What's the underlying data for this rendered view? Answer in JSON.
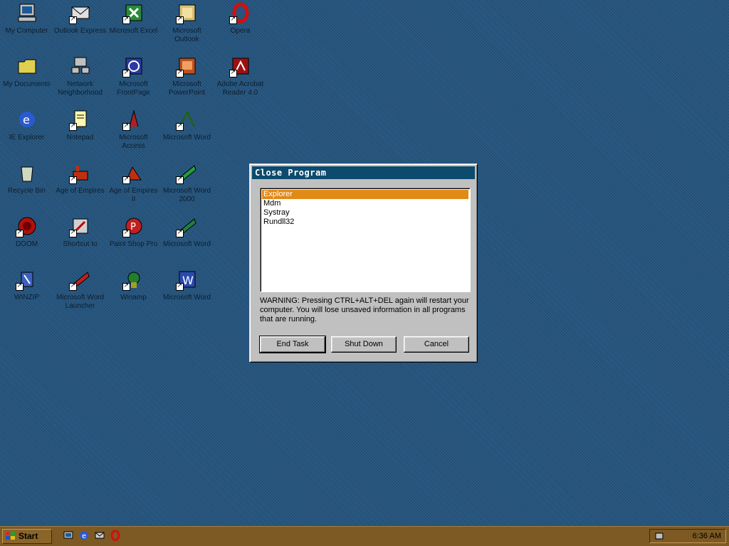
{
  "desktop": {
    "icons": [
      {
        "label": "My Computer"
      },
      {
        "label": "Outlook Express"
      },
      {
        "label": "Microsoft Excel"
      },
      {
        "label": "Microsoft Outlook"
      },
      {
        "label": "Opera"
      },
      {
        "label": "My Documents"
      },
      {
        "label": "Network Neighborhood"
      },
      {
        "label": "Microsoft FrontPage"
      },
      {
        "label": "Microsoft PowerPoint"
      },
      {
        "label": "Adobe Acrobat Reader 4.0"
      },
      {
        "label": "IE Explorer"
      },
      {
        "label": "Notepad"
      },
      {
        "label": "Microsoft Access"
      },
      {
        "label": "Microsoft Word"
      },
      {
        "label": "Recycle Bin"
      },
      {
        "label": "Age of Empires"
      },
      {
        "label": "Age of Empires II"
      },
      {
        "label": "Microsoft Word 2000"
      },
      {
        "label": "DOOM"
      },
      {
        "label": "Shortcut to"
      },
      {
        "label": "Paint Shop Pro"
      },
      {
        "label": "Microsoft Word"
      },
      {
        "label": "WINZIP"
      },
      {
        "label": "Microsoft Word Launcher"
      },
      {
        "label": "Winamp"
      },
      {
        "label": "Microsoft Word"
      }
    ]
  },
  "dialog": {
    "title": "Close Program",
    "tasks": [
      "Explorer",
      "Mdm",
      "Systray",
      "Rundll32"
    ],
    "selected_task": "Explorer",
    "warning": "WARNING: Pressing CTRL+ALT+DEL again will restart your computer. You will lose unsaved information in all programs that are running.",
    "buttons": {
      "end_task": "End Task",
      "shut_down": "Shut Down",
      "cancel": "Cancel"
    }
  },
  "taskbar": {
    "start_label": "Start",
    "clock": "6:36 AM"
  },
  "colors": {
    "desktop": "#2a5a84",
    "titlebar": "#0c4b6e",
    "selection": "#e08a18",
    "taskbar": "#7d5a23"
  }
}
